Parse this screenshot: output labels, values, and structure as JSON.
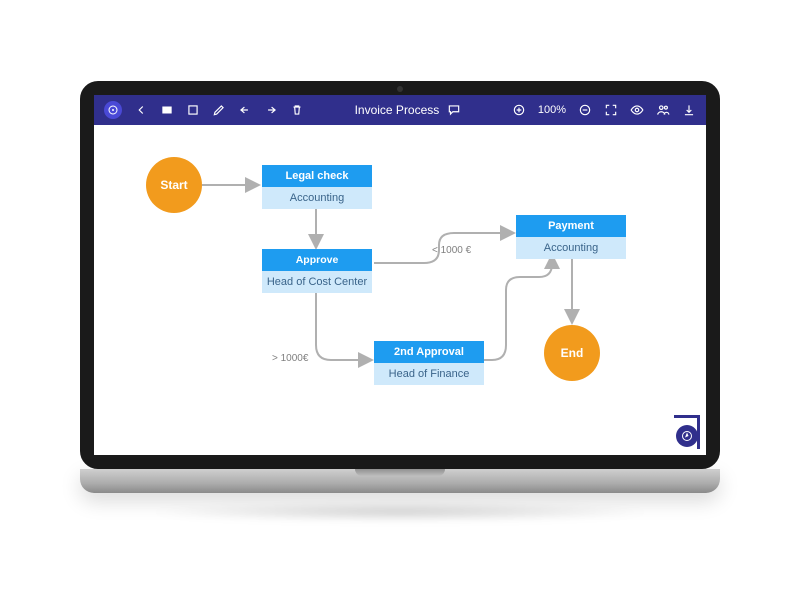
{
  "toolbar": {
    "title": "Invoice Process",
    "zoom_label": "100%"
  },
  "nodes": {
    "start": "Start",
    "end": "End",
    "legal_check": {
      "title": "Legal check",
      "sub": "Accounting"
    },
    "approve": {
      "title": "Approve",
      "sub": "Head of Cost Center"
    },
    "second_approval": {
      "title": "2nd Approval",
      "sub": "Head of Finance"
    },
    "payment": {
      "title": "Payment",
      "sub": "Accounting"
    }
  },
  "edges": {
    "approve_to_payment": "< 1000 €",
    "approve_to_second": "> 1000€"
  },
  "colors": {
    "toolbar_bg": "#302f8c",
    "node_circle": "#f29b1d",
    "node_box_title": "#1e9cf0",
    "node_box_sub": "#cfe9fb",
    "arrow": "#b0b0b0"
  }
}
